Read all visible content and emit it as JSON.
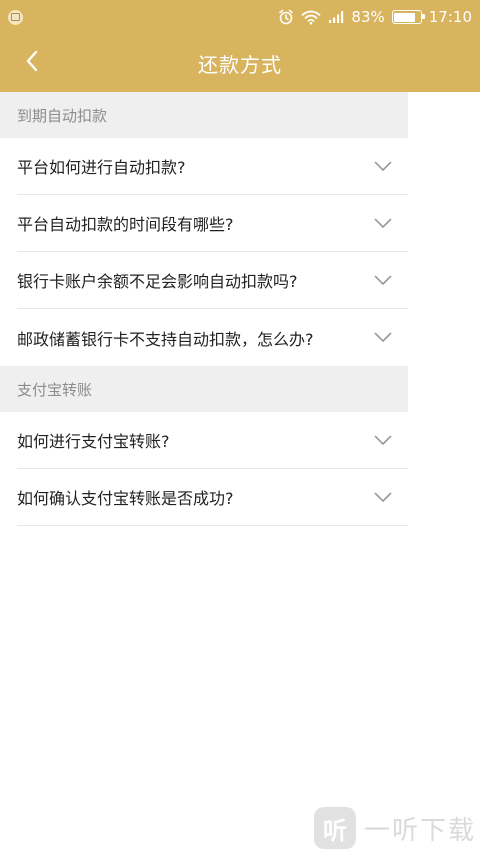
{
  "status_bar": {
    "battery_percent": "83%",
    "battery_level": 0.83,
    "time": "17:10",
    "icons": [
      "app-notification-icon",
      "alarm-icon",
      "wifi-icon",
      "signal-icon",
      "battery-icon"
    ]
  },
  "header": {
    "title": "还款方式",
    "back_icon": "chevron-left-icon"
  },
  "sections": [
    {
      "title": "到期自动扣款",
      "items": [
        "平台如何进行自动扣款?",
        "平台自动扣款的时间段有哪些?",
        "银行卡账户余额不足会影响自动扣款吗?",
        "邮政储蓄银行卡不支持自动扣款，怎么办?"
      ]
    },
    {
      "title": "支付宝转账",
      "items": [
        "如何进行支付宝转账?",
        "如何确认支付宝转账是否成功?"
      ]
    }
  ],
  "watermark": {
    "logo_char": "听",
    "text": "一听下载"
  },
  "colors": {
    "accent": "#d8b45e",
    "section_bg": "#efefef",
    "divider": "#e6e6e6"
  }
}
